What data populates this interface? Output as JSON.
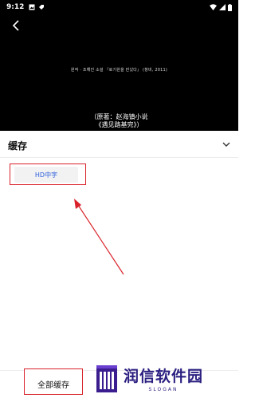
{
  "status_bar": {
    "time": "9:12"
  },
  "video": {
    "credit_line": "원작 · 조해진 소설 『로기완을 만났다』 (창비, 2011)",
    "subtitle_line1": "（原著：赵海镇小说",
    "subtitle_line2": "《遇见路基完》）"
  },
  "panel": {
    "title": "缓存",
    "options": [
      {
        "label": "HD中字"
      }
    ]
  },
  "bottom": {
    "download_all_label": "全部缓存"
  },
  "watermark": {
    "name": "润信软件园",
    "slogan": "SLOGAN"
  },
  "colors": {
    "accent_blue": "#2b5ddb",
    "annotation_red": "#d9222a",
    "watermark_purple": "#2a1f80"
  }
}
